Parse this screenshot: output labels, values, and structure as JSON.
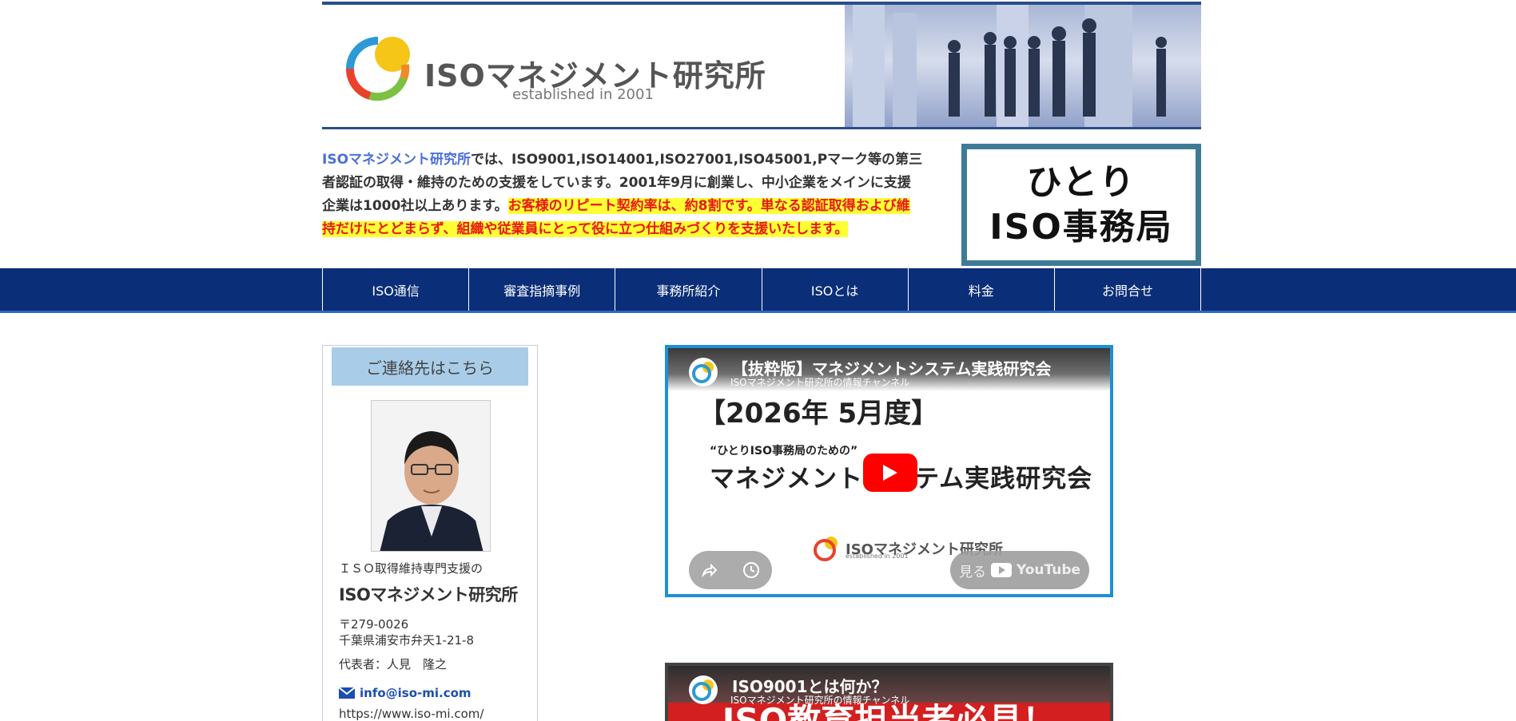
{
  "header": {
    "logo_title": "ISOマネジメント研究所",
    "logo_sub": "established in 2001"
  },
  "intro": {
    "link": "ISOマネジメント研究所",
    "text1": "では、ISO9001,ISO14001,ISO27001,ISO45001,Pマーク等の第三者認証の取得・維持のための支援をしています。2001年9月に創業し、中小企業をメインに支援企業は1000社以上あります。",
    "highlight": "お客様のリピート契約率は、約8割です。単なる認証取得および維持だけにとどまらず、組織や従業員にとって役に立つ仕組みづくりを支援いたします。"
  },
  "hitori": {
    "line1": "ひとり",
    "line2": "ISO事務局"
  },
  "nav": {
    "items": [
      "ISO通信",
      "審査指摘事例",
      "事務所紹介",
      "ISOとは",
      "料金",
      "お問合せ"
    ]
  },
  "sidebar": {
    "title": "ご連絡先はこちら",
    "tagline": "ＩＳＯ取得維持専門支援の",
    "brand": "ISOマネジメント研究所",
    "postal": "〒279-0026",
    "address": "千葉県浦安市弁天1-21-8",
    "rep": "代表者：人見　隆之",
    "email": "info@iso-mi.com",
    "url": "https://www.iso-mi.com/"
  },
  "video1": {
    "title": "【抜粋版】マネジメントシステム実践研究会",
    "channel": "ISOマネジメント研究所の情報チャンネル",
    "big": "【2026年 5月度】",
    "small": "“ひとりISO事務局のための”",
    "headline": "マネジメントシステム実践研究会",
    "logo_text": "ISOマネジメント研究所",
    "logo_sub": "established in 2001",
    "watch": "見る",
    "yt": "YouTube"
  },
  "video2": {
    "title": "ISO9001とは何か？",
    "channel": "ISOマネジメント研究所の情報チャンネル",
    "banner": "ISO教育担当者必見！"
  },
  "colors": {
    "nav_bg": "#0b2e78",
    "accent_blue": "#1f8fd6",
    "highlight_yellow": "#ffff33",
    "highlight_red": "#e61919",
    "hitori_border": "#3d7b94"
  }
}
